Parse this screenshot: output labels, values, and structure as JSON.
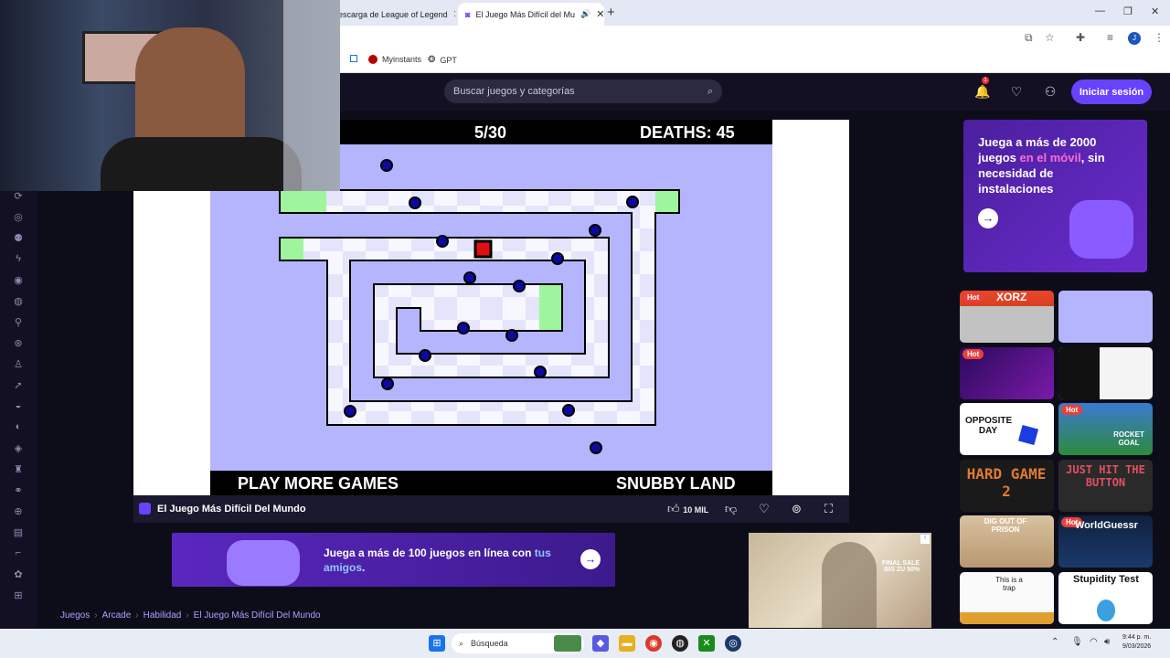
{
  "browser": {
    "tabs": [
      {
        "label": "escarga de League of Legend"
      },
      {
        "label": "El Juego Más Difícil del Mu"
      }
    ],
    "bookmarks": [
      {
        "label": "Myinstants"
      },
      {
        "label": "GPT"
      }
    ],
    "profile_initial": "J"
  },
  "site": {
    "search_placeholder": "Buscar juegos y categorías",
    "notification_count": "1",
    "login_label": "Iniciar sesión"
  },
  "game": {
    "level": "5/30",
    "deaths": "DEATHS: 45",
    "footer_left": "PLAY MORE GAMES",
    "footer_right": "SNUBBY LAND",
    "title": "El Juego Más Difícil Del Mundo",
    "likes": "10 MIL"
  },
  "promo": {
    "line1": "Juega a más de 2000 juegos ",
    "highlight": "en el móvil",
    "line2": ", sin necesidad de instalaciones"
  },
  "banner": {
    "text": "Juega a más de 100 juegos en línea con ",
    "highlight": "tus amigos",
    "end": "."
  },
  "sidead": {
    "text": "FINAL SALE\nBIS ZU 50%"
  },
  "thumbnails": [
    {
      "label": "XORZ",
      "hot": "Hot"
    },
    {
      "label": "",
      "hot": ""
    },
    {
      "label": "",
      "hot": "Hot"
    },
    {
      "label": "",
      "hot": ""
    },
    {
      "label": "OPPOSITE DAY",
      "hot": ""
    },
    {
      "label": "ROCKET GOAL",
      "hot": "Hot"
    },
    {
      "label": "HARD GAME 2",
      "hot": ""
    },
    {
      "label": "JUST HIT THE BUTTON",
      "hot": ""
    },
    {
      "label": "DIG OUT OF PRISON",
      "hot": ""
    },
    {
      "label": "WorldGuessr",
      "hot": "Hot"
    },
    {
      "label": "This is a trap",
      "hot": ""
    },
    {
      "label": "Stupidity Test",
      "hot": ""
    }
  ],
  "breadcrumb": [
    "Juegos",
    "Arcade",
    "Habilidad",
    "El Juego Más Difícil Del Mundo"
  ],
  "taskbar": {
    "search": "Búsqueda",
    "time": "9:44 p. m.",
    "date": "9/03/2026"
  },
  "colors": {
    "accent": "#6842ff",
    "game_bg": "#b4b5fd",
    "enemy": "#0a0a9e",
    "player": "#e01010",
    "safe_zone": "#9ef59e"
  }
}
